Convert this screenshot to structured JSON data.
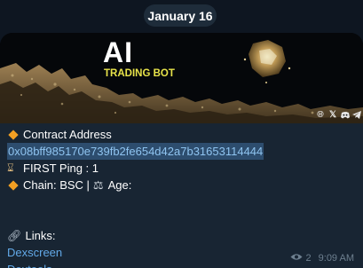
{
  "date_separator": "January 16",
  "banner": {
    "title": "AI",
    "subtitle": "TRADING BOT",
    "social_icons": [
      "globe-icon",
      "x-icon",
      "discord-icon",
      "telegram-icon"
    ]
  },
  "message": {
    "contract_label": "Contract Address",
    "contract_address": "0x08bff985170e739fb2fe654d42a7b31653114444",
    "first_ping": "FIRST Ping : 1",
    "chain": "Chain: BSC |",
    "age": "Age:",
    "links_label": "Links:",
    "links": [
      "Dexscreen",
      "Dextools"
    ]
  },
  "meta": {
    "views": "2",
    "time": "9:09 AM"
  },
  "colors": {
    "background": "#0e1621",
    "bubble": "#182533",
    "link": "#62a9e8",
    "accent_yellow": "#e8e34a",
    "diamond": "#f3a023"
  }
}
